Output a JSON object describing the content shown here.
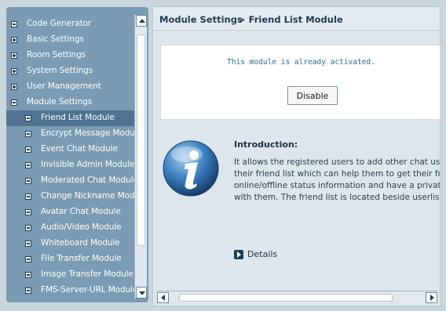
{
  "sidebar": {
    "items": [
      {
        "label": "Code Generator",
        "icon": "collapse-icon",
        "level": "top",
        "selected": false
      },
      {
        "label": "Basic Settings",
        "icon": "expand-icon",
        "level": "top",
        "selected": false
      },
      {
        "label": "Room Settings",
        "icon": "expand-icon",
        "level": "top",
        "selected": false
      },
      {
        "label": "System Settings",
        "icon": "expand-icon",
        "level": "top",
        "selected": false
      },
      {
        "label": "User Management",
        "icon": "expand-icon",
        "level": "top",
        "selected": false
      },
      {
        "label": "Module Settings",
        "icon": "collapse-icon",
        "level": "top",
        "selected": false
      },
      {
        "label": "Friend List Module",
        "icon": "collapse-icon",
        "level": "sub",
        "selected": true
      },
      {
        "label": "Encrypt Message Module",
        "icon": "collapse-icon",
        "level": "sub",
        "selected": false
      },
      {
        "label": "Event Chat Module",
        "icon": "collapse-icon",
        "level": "sub",
        "selected": false
      },
      {
        "label": "Invisible Admin Module",
        "icon": "collapse-icon",
        "level": "sub",
        "selected": false
      },
      {
        "label": "Moderated Chat Module",
        "icon": "collapse-icon",
        "level": "sub",
        "selected": false
      },
      {
        "label": "Change Nickname Module",
        "icon": "collapse-icon",
        "level": "sub",
        "selected": false
      },
      {
        "label": "Avatar Chat Module",
        "icon": "collapse-icon",
        "level": "sub",
        "selected": false
      },
      {
        "label": "Audio/Video Module",
        "icon": "collapse-icon",
        "level": "sub",
        "selected": false
      },
      {
        "label": "Whiteboard Module",
        "icon": "collapse-icon",
        "level": "sub",
        "selected": false
      },
      {
        "label": "File Transfer Module",
        "icon": "collapse-icon",
        "level": "sub",
        "selected": false
      },
      {
        "label": "Image Transfer Module",
        "icon": "collapse-icon",
        "level": "sub",
        "selected": false
      },
      {
        "label": "FMS-Server-URL Module",
        "icon": "collapse-icon",
        "level": "sub",
        "selected": false
      }
    ]
  },
  "header": {
    "title": "Module Settings",
    "breadcrumb": "> Friend List Module"
  },
  "status": {
    "message": "This module is already activated.",
    "button_label": "Disable"
  },
  "intro": {
    "icon": "info-icon",
    "title": "Introduction:",
    "lines": [
      "It allows the registered users to add other chat users to",
      "their friend list which can help them to get their friends'",
      "online/offline status information and have a private chat",
      "with them. The friend list is located beside userlist."
    ]
  },
  "details": {
    "label": "Details",
    "icon": "play-arrow-icon"
  },
  "colors": {
    "sidebar_bg": "#7a9bb3",
    "selected_bg": "#4f7390",
    "header_text": "#1d3d57",
    "status_text": "#2a6a8a"
  }
}
